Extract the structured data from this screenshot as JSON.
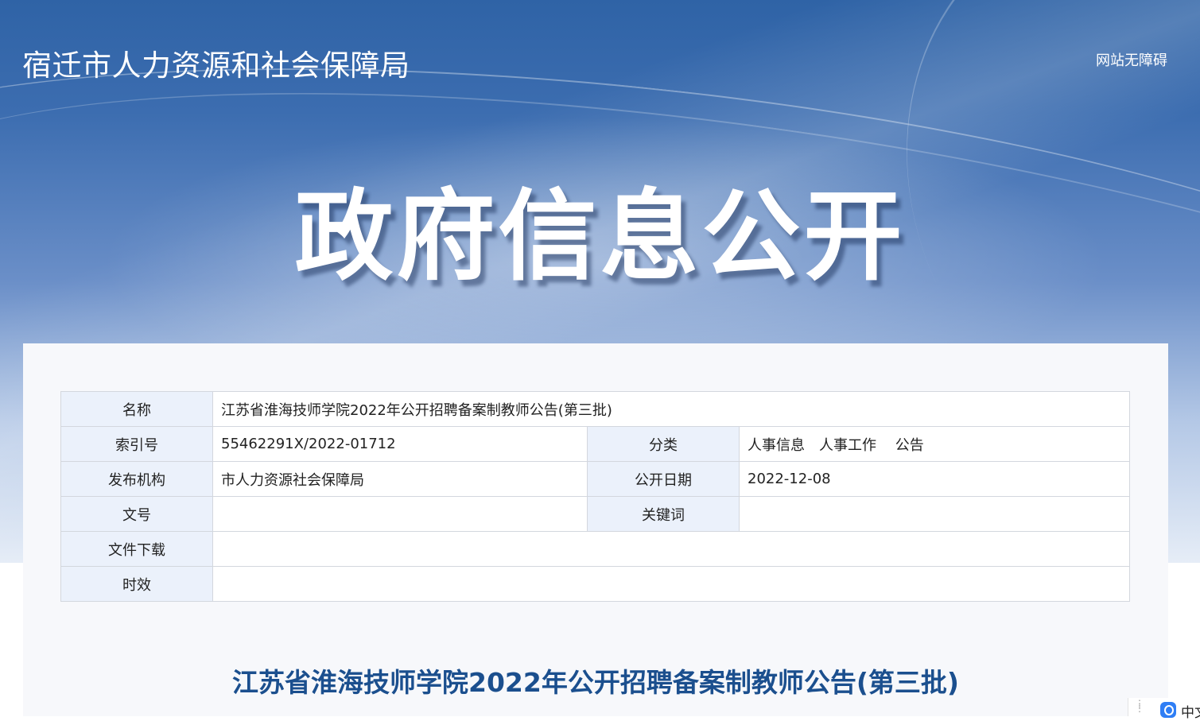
{
  "header": {
    "site_title": "宿迁市人力资源和社会保障局",
    "accessibility_link": "网站无障碍",
    "hero_title": "政府信息公开"
  },
  "info_table": {
    "name_label": "名称",
    "name_value": "江苏省淮海技师学院2022年公开招聘备案制教师公告(第三批)",
    "index_label": "索引号",
    "index_value": "55462291X/2022-01712",
    "category_label": "分类",
    "category_value": "人事信息　人事工作　 公告",
    "publisher_label": "发布机构",
    "publisher_value": "市人力资源社会保障局",
    "date_label": "公开日期",
    "date_value": "2022-12-08",
    "doc_no_label": "文号",
    "doc_no_value": "",
    "keywords_label": "关键词",
    "keywords_value": "",
    "download_label": "文件下载",
    "download_value": "",
    "validity_label": "时效",
    "validity_value": ""
  },
  "article": {
    "title": "江苏省淮海技师学院2022年公开招聘备案制教师公告(第三批)"
  },
  "float_tool": {
    "lang_label": "中文"
  }
}
